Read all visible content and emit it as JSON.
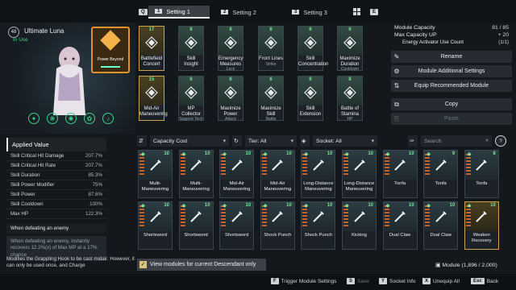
{
  "tabs": {
    "left_key": "Q",
    "right_key": "E",
    "settings": [
      {
        "num": "1",
        "label": "Setting 1"
      },
      {
        "num": "2",
        "label": "Setting 2"
      },
      {
        "num": "3",
        "label": "Setting 3"
      }
    ]
  },
  "character": {
    "level": "48",
    "name": "Ultimate Luna",
    "status": "In Use",
    "core_module": "Power Beyond"
  },
  "equipped": [
    {
      "capacity": "17",
      "name": "Battlefield Concert",
      "sub": "",
      "gold": true
    },
    {
      "capacity": "8",
      "name": "Skill Insight",
      "sub": "",
      "gold": false
    },
    {
      "capacity": "8",
      "name": "Emergency Measures",
      "sub": "Lock",
      "gold": false
    },
    {
      "capacity": "8",
      "name": "Front Lines",
      "sub": "Strike",
      "gold": false
    },
    {
      "capacity": "6",
      "name": "Skill Concentration",
      "sub": "",
      "gold": false
    },
    {
      "capacity": "6",
      "name": "Maximize Duration",
      "sub": "Cooldown",
      "gold": false
    },
    {
      "capacity": "15",
      "name": "Mid-Air Maneuvering",
      "sub": "",
      "gold": true
    },
    {
      "capacity": "6",
      "name": "MP Collector",
      "sub": "Support Tech",
      "gold": false
    },
    {
      "capacity": "6",
      "name": "Maximize Power",
      "sub": "Attack",
      "gold": false
    },
    {
      "capacity": "6",
      "name": "Maximize Skill",
      "sub": "Battle",
      "gold": false
    },
    {
      "capacity": "6",
      "name": "Skill Extension",
      "sub": "",
      "gold": false
    },
    {
      "capacity": "8",
      "name": "Battle of Stamina",
      "sub": "HP",
      "gold": false
    }
  ],
  "applied": {
    "title": "Applied Value",
    "stats": [
      {
        "label": "Skill Critical Hit Damage",
        "value": "207.7%"
      },
      {
        "label": "Skill Critical Hit Rate",
        "value": "207.7%"
      },
      {
        "label": "Skill Duration",
        "value": "85.3%"
      },
      {
        "label": "Skill Power Modifier",
        "value": "75%"
      },
      {
        "label": "Skill Power",
        "value": "87.6%"
      },
      {
        "label": "Skill Cooldown",
        "value": "100%"
      },
      {
        "label": "Max HP",
        "value": "122.3%"
      }
    ],
    "defeat_title": "When defeating an enemy",
    "defeat_body": "When defeating an enemy, instantly recovers 12.2%(x) of Max MP at a 17% chance",
    "grapple": "Modifies the Grappling Hook to be cast midair. However, it can only be used once, and Charge"
  },
  "right_menu": {
    "module_capacity_label": "Module Capacity",
    "module_capacity_value": "81 / 85",
    "max_capacity_label": "Max Capacity UP",
    "max_capacity_value": "+ 20",
    "activator_label": "Energy Activator Use Count",
    "activator_value": "(1/1)",
    "buttons": [
      "Rename",
      "Module Additional Settings",
      "Equip Recommended Module",
      "Copy",
      "Paste"
    ]
  },
  "filters": {
    "sort": "Capacity Cost",
    "tier": "Tier: All",
    "socket": "Socket: All",
    "search_placeholder": "Search"
  },
  "inventory": [
    {
      "capacity": "10",
      "name": "Multi-Maneuvering",
      "gold": false
    },
    {
      "capacity": "10",
      "name": "Multi-Maneuvering",
      "gold": false
    },
    {
      "capacity": "10",
      "name": "Mid-Air Maneuvering",
      "gold": false
    },
    {
      "capacity": "10",
      "name": "Mid-Air Maneuvering",
      "gold": false
    },
    {
      "capacity": "10",
      "name": "Long-Distance Maneuvering",
      "gold": false
    },
    {
      "capacity": "10",
      "name": "Long-Distance Maneuvering",
      "gold": false
    },
    {
      "capacity": "10",
      "name": "Tonfa",
      "gold": false
    },
    {
      "capacity": "9",
      "name": "Tonfa",
      "gold": false
    },
    {
      "capacity": "8",
      "name": "Tonfa",
      "gold": false
    },
    {
      "capacity": "10",
      "name": "Shortsword",
      "gold": false
    },
    {
      "capacity": "10",
      "name": "Shortsword",
      "gold": false
    },
    {
      "capacity": "10",
      "name": "Shortsword",
      "gold": false
    },
    {
      "capacity": "10",
      "name": "Shock Punch",
      "gold": false
    },
    {
      "capacity": "10",
      "name": "Shock Punch",
      "gold": false
    },
    {
      "capacity": "10",
      "name": "Kicking",
      "gold": false
    },
    {
      "capacity": "10",
      "name": "Dual Claw",
      "gold": false
    },
    {
      "capacity": "10",
      "name": "Dual Claw",
      "gold": false
    },
    {
      "capacity": "10",
      "name": "Weaken Recovery",
      "gold": true
    }
  ],
  "bottom": {
    "view_only": "View modules for current Descendant only",
    "module_count": "Module (1,896 / 2,000)",
    "hints": [
      {
        "key": "F",
        "label": "Trigger Module Settings",
        "dim": false
      },
      {
        "key": "S",
        "label": "Save",
        "dim": true
      },
      {
        "key": "Y",
        "label": "Socket Info",
        "dim": false
      },
      {
        "key": "X",
        "label": "Unequip All",
        "dim": false
      },
      {
        "key": "Esc",
        "label": "Back",
        "dim": false
      }
    ]
  },
  "colors": {
    "accent_gold": "#caa24a",
    "accent_green": "#4fd27a",
    "orange": "#e0922a"
  }
}
